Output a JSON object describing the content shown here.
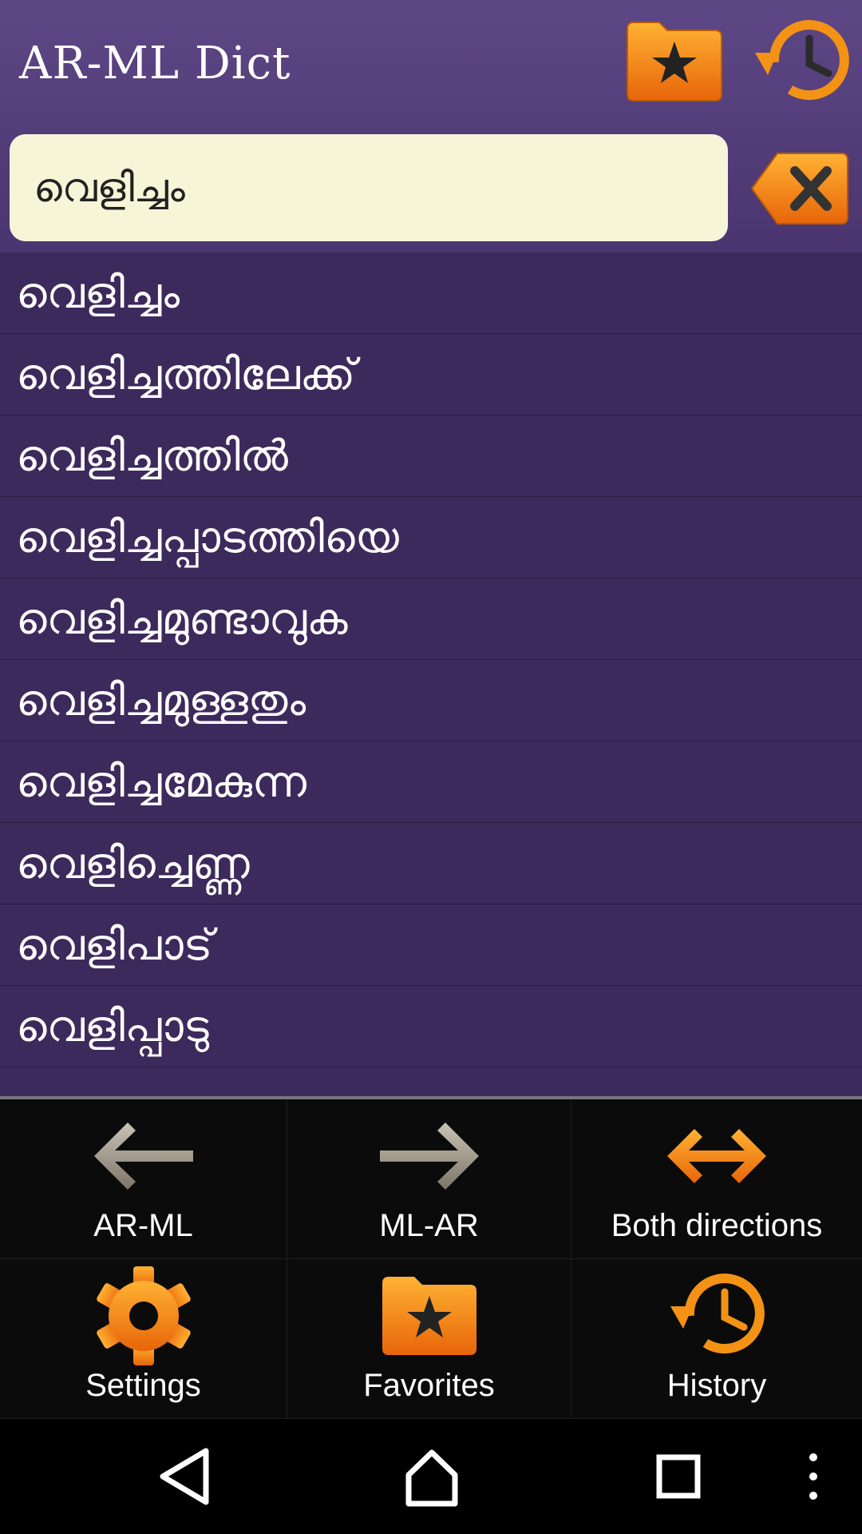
{
  "app": {
    "title": "AR-ML Dict"
  },
  "header": {
    "favorites_icon": "folder-star-icon",
    "history_icon": "clock-history-icon"
  },
  "search": {
    "value": "വെളിച്ചം",
    "clear_icon": "clear-x-icon"
  },
  "results": [
    "വെളിച്ചം",
    "വെളിച്ചത്തിലേക്ക്",
    "വെളിച്ചത്തിൽ",
    "വെളിച്ചപ്പാടത്തിയെ",
    "വെളിച്ചമുണ്ടാവുക",
    "വെളിച്ചമുള്ളതും",
    "വെളിച്ചമേകുന്ന",
    "വെളിച്ചെണ്ണ",
    "വെളിപാട്",
    "വെളിപ്പാടു"
  ],
  "menu": {
    "ar_ml": "AR-ML",
    "ml_ar": "ML-AR",
    "both": "Both directions",
    "settings": "Settings",
    "favorites": "Favorites",
    "history": "History"
  },
  "colors": {
    "accent": "#f39c12",
    "header": "#5a4480",
    "list_bg": "#3d2a5c",
    "search_bg": "#f7f5d8"
  }
}
